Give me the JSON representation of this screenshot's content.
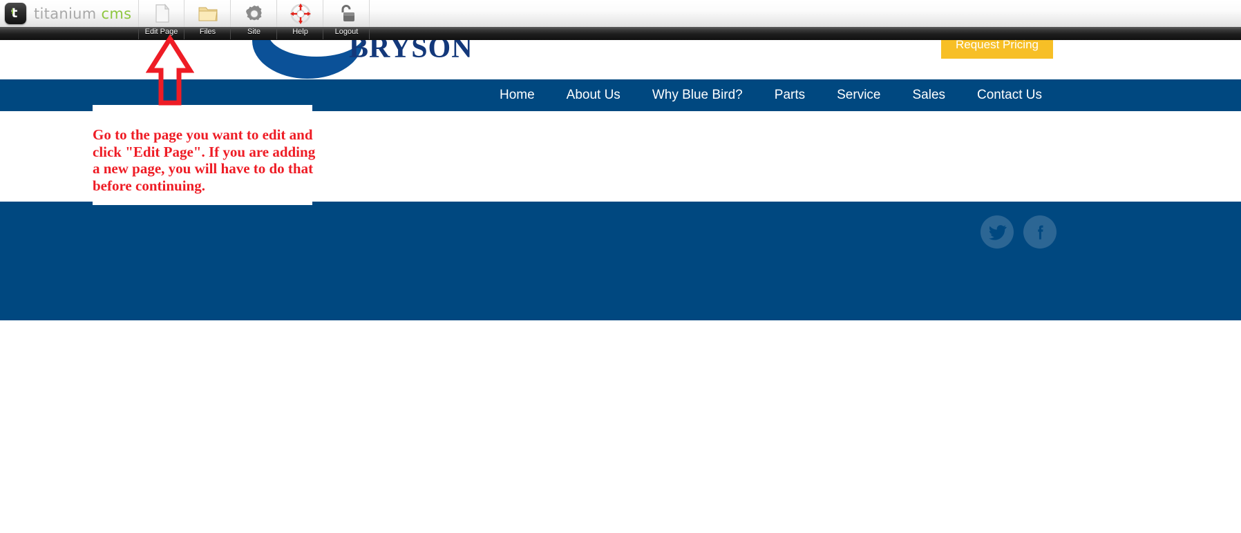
{
  "cms_toolbar": {
    "logo": {
      "badge_letter": "t",
      "badge_accent": "i",
      "word": "titanium",
      "word_accent": "cms"
    },
    "items": [
      {
        "label": "Edit Page",
        "icon": "page-icon"
      },
      {
        "label": "Files",
        "icon": "folder-icon"
      },
      {
        "label": "Site",
        "icon": "gear-icon"
      },
      {
        "label": "Help",
        "icon": "life-ring-icon"
      },
      {
        "label": "Logout",
        "icon": "open-padlock-icon"
      }
    ]
  },
  "site": {
    "brand": {
      "word": "BRYSON",
      "swoosh_color": "#0b5198",
      "word_color": "#13387a"
    },
    "cta": {
      "label": "Request Pricing",
      "bg": "#f7bf26",
      "text_color": "#ffffff"
    },
    "nav": {
      "bg": "#004880",
      "items": [
        {
          "label": "Home"
        },
        {
          "label": "About Us"
        },
        {
          "label": "Why Blue Bird?"
        },
        {
          "label": "Parts"
        },
        {
          "label": "Service"
        },
        {
          "label": "Sales"
        },
        {
          "label": "Contact Us"
        }
      ]
    },
    "footer": {
      "bg": "#004880",
      "social": [
        {
          "name": "twitter",
          "label": "Twitter"
        },
        {
          "name": "facebook",
          "label": "Facebook"
        }
      ]
    }
  },
  "annotation": {
    "color": "#ee1c25",
    "text": "Go to the page you want to edit and click \"Edit Page\". If you are adding a new page, you will have to do that before continuing.",
    "arrow_target": "Edit Page"
  }
}
